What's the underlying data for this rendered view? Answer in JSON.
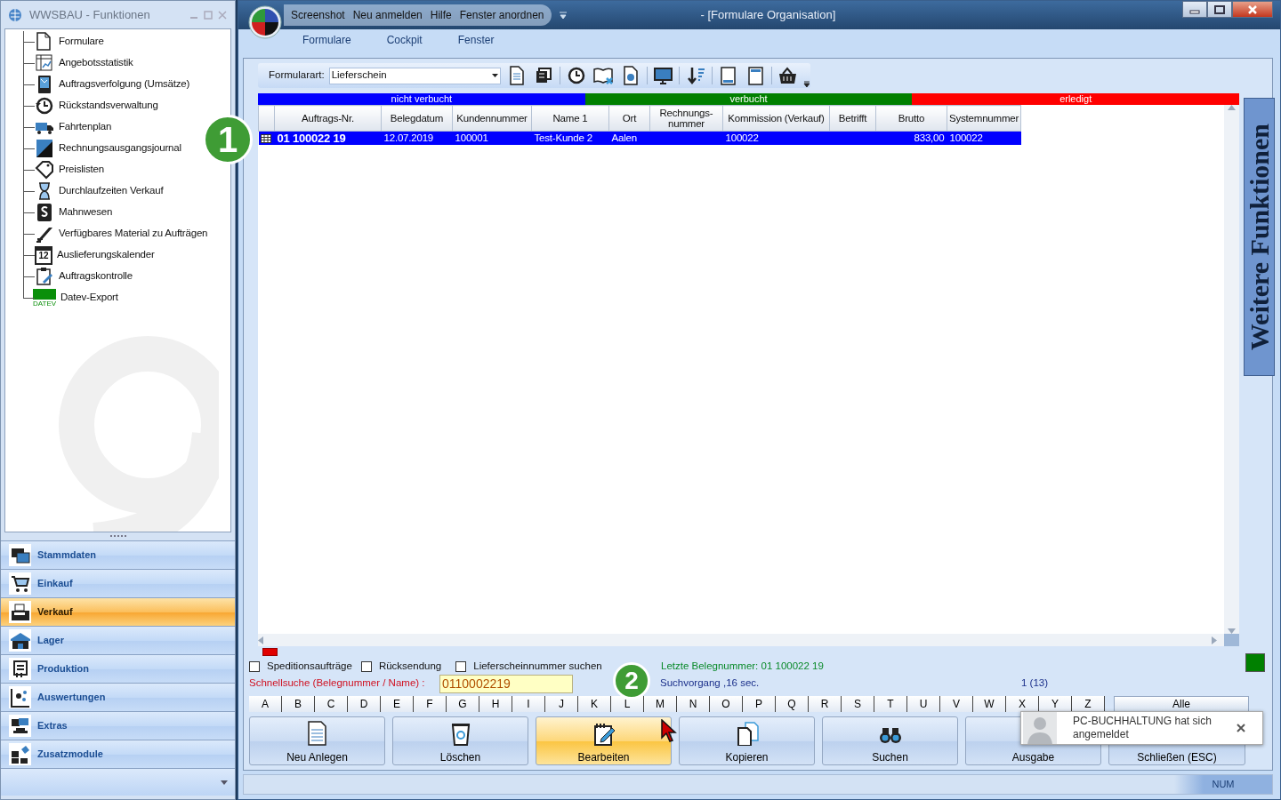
{
  "left_window": {
    "title": "WWSBAU - Funktionen",
    "tree": [
      {
        "label": "Formulare"
      },
      {
        "label": "Angebotsstatistik"
      },
      {
        "label": "Auftragsverfolgung (Umsätze)"
      },
      {
        "label": "Rückstandsverwaltung"
      },
      {
        "label": "Fahrtenplan"
      },
      {
        "label": "Rechnungsausgangsjournal"
      },
      {
        "label": "Preislisten"
      },
      {
        "label": "Durchlaufzeiten Verkauf"
      },
      {
        "label": "Mahnwesen"
      },
      {
        "label": "Verfügbares Material zu Aufträgen"
      },
      {
        "label": "Auslieferungskalender",
        "icon_label": "12"
      },
      {
        "label": "Auftragskontrolle"
      },
      {
        "label": "Datev-Export",
        "icon_label": "DATEV"
      }
    ],
    "nav": [
      {
        "label": "Stammdaten",
        "selected": false
      },
      {
        "label": "Einkauf",
        "selected": false
      },
      {
        "label": "Verkauf",
        "selected": true
      },
      {
        "label": "Lager",
        "selected": false
      },
      {
        "label": "Produktion",
        "selected": false
      },
      {
        "label": "Auswertungen",
        "selected": false
      },
      {
        "label": "Extras",
        "selected": false
      },
      {
        "label": "Zusatzmodule",
        "selected": false
      }
    ]
  },
  "main_window": {
    "quick_access": [
      "Screenshot",
      "Neu anmelden",
      "Hilfe",
      "Fenster anordnen"
    ],
    "title": "- [Formulare Organisation]",
    "menu": [
      "Formulare",
      "Cockpit",
      "Fenster"
    ]
  },
  "toolbar": {
    "label": "Formularart:",
    "value": "Lieferschein"
  },
  "status_legend": [
    {
      "label": "nicht verbucht",
      "color": "#0000ff"
    },
    {
      "label": "verbucht",
      "color": "#008000"
    },
    {
      "label": "erledigt",
      "color": "#ff0000"
    }
  ],
  "table": {
    "columns": [
      {
        "label": "Auftrags-Nr."
      },
      {
        "label": "Belegdatum"
      },
      {
        "label": "Kundennummer"
      },
      {
        "label": "Name 1"
      },
      {
        "label": "Ort"
      },
      {
        "label": "Rechnungs-nummer"
      },
      {
        "label": "Kommission (Verkauf)"
      },
      {
        "label": "Betrifft"
      },
      {
        "label": "Brutto",
        "numeric": true
      },
      {
        "label": "Systemnummer"
      }
    ],
    "rows": [
      {
        "selected": true,
        "cells": [
          "01 100022 19",
          "12.07.2019",
          "100001",
          "Test-Kunde 2",
          "Aalen",
          null,
          "100022",
          null,
          "833,00",
          "100022"
        ]
      }
    ]
  },
  "filters": [
    {
      "label": "Speditionsaufträge",
      "checked": false
    },
    {
      "label": "Rücksendung",
      "checked": false
    },
    {
      "label": "Lieferscheinnummer suchen",
      "checked": false
    }
  ],
  "quick_search": {
    "label": "Schnellsuche (Belegnummer / Name) :",
    "value": "0110002219"
  },
  "last_number": "Letzte Belegnummer: 01 100022 19",
  "search_time": "Suchvorgang ,16 sec.",
  "count": "1 (13)",
  "letters": [
    "A",
    "B",
    "C",
    "D",
    "E",
    "F",
    "G",
    "H",
    "I",
    "J",
    "K",
    "L",
    "M",
    "N",
    "O",
    "P",
    "Q",
    "R",
    "S",
    "T",
    "U",
    "V",
    "W",
    "X",
    "Y",
    "Z"
  ],
  "all_button": "Alle",
  "actions": [
    {
      "label": "Neu Anlegen",
      "selected": false
    },
    {
      "label": "Löschen",
      "selected": false
    },
    {
      "label": "Bearbeiten",
      "selected": true
    },
    {
      "label": "Kopieren",
      "selected": false
    },
    {
      "label": "Suchen",
      "selected": false
    },
    {
      "label": "Ausgabe",
      "selected": false
    },
    {
      "label": "Schließen (ESC)",
      "selected": false
    }
  ],
  "notification": {
    "text": "PC-BUCHHALTUNG hat sich angemeldet"
  },
  "side_tab": "Weitere Funktionen",
  "status_bar": "NUM",
  "annotations": [
    "1",
    "2"
  ]
}
